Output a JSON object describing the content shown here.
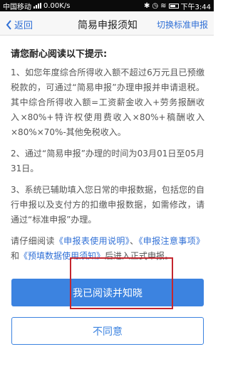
{
  "status_bar": {
    "carrier": "中国移动",
    "speed": "0.00K/s",
    "time": "下午3:44"
  },
  "nav": {
    "back_label": "返回",
    "title": "简易申报须知",
    "right_label": "切换标准申报"
  },
  "content": {
    "heading": "请您耐心阅读以下提示:",
    "item1": "1、如您年度综合所得收入额不超过6万元且已预缴税款的，可通过“简易申报”办理申报并申请退税。其中综合所得收入额=工资薪金收入+劳务报酬收入×80%+特许权使用费收入×80%+稿酬收入×80%×70%-其他免税收入。",
    "item2": "2、通过“简易申报”办理的时间为03月01日至05月31日。",
    "item3": "3、系统已辅助填入您日常的申报数据，包括您的自行申报以及支付方的扣缴申报数据，如需修改，请通过“标准申报”办理。",
    "read_prefix": "请仔细阅读",
    "link1": "《申报表使用说明》",
    "sep1": "、",
    "link2": "《申报注意事项》",
    "and": "和",
    "link3": "《预填数据使用须知》",
    "read_suffix": "后进入正式申报。"
  },
  "buttons": {
    "confirm": "我已阅读并知晓",
    "disagree": "不同意"
  },
  "colors": {
    "accent": "#3c83e0",
    "link": "#2f6fd6",
    "highlight": "#c5262e"
  }
}
